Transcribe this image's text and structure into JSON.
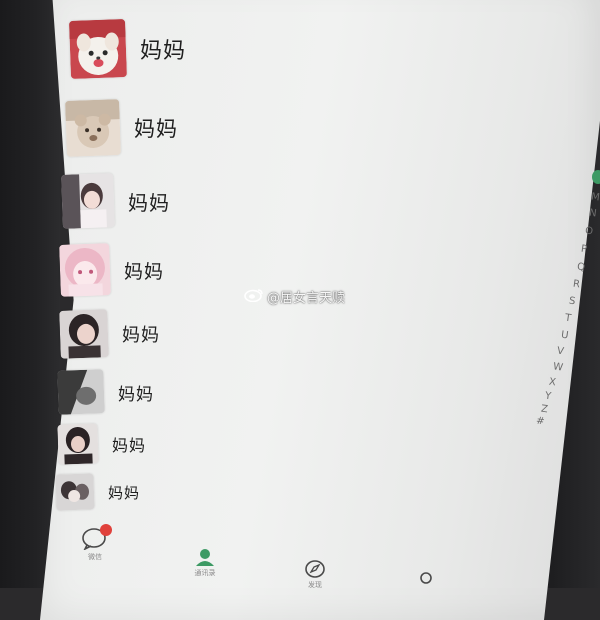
{
  "contacts": [
    {
      "name": "妈妈",
      "avatar": "cat-dog-avatar"
    },
    {
      "name": "妈妈",
      "avatar": "teddy-bear-avatar"
    },
    {
      "name": "妈妈",
      "avatar": "girl-photo-avatar"
    },
    {
      "name": "妈妈",
      "avatar": "anime-girl-avatar"
    },
    {
      "name": "妈妈",
      "avatar": "girl-selfie-avatar"
    },
    {
      "name": "妈妈",
      "avatar": "monochrome-photo-avatar"
    },
    {
      "name": "妈妈",
      "avatar": "portrait-avatar"
    },
    {
      "name": "妈妈",
      "avatar": "group-photo-avatar"
    }
  ],
  "index_letters": [
    "M",
    "N",
    "O",
    "P",
    "Q",
    "R",
    "S",
    "T",
    "U",
    "V",
    "W",
    "X",
    "Y",
    "Z",
    "#"
  ],
  "watermark": {
    "text": "@居女言天赎"
  },
  "tabs": [
    {
      "label": "微信",
      "icon": "chat-bubble-icon",
      "active": true
    },
    {
      "label": "通讯录",
      "icon": "contacts-icon",
      "active": false
    },
    {
      "label": "发现",
      "icon": "compass-icon",
      "active": false
    },
    {
      "label": "",
      "icon": "me-icon",
      "active": false
    }
  ],
  "colors": {
    "accent": "#3d9a64",
    "badge": "#e0413b",
    "screen": "#eeefee"
  }
}
